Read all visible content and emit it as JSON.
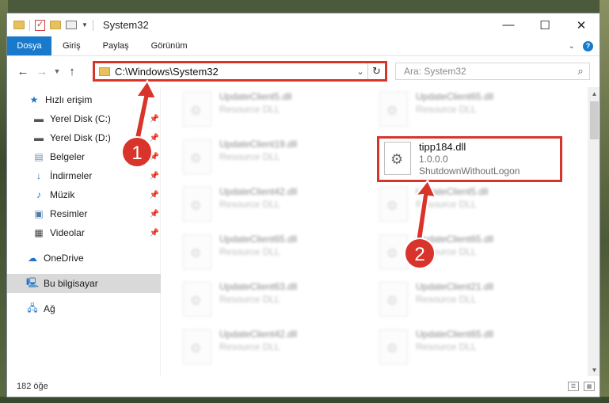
{
  "window": {
    "title": "System32",
    "controls": {
      "minimize": "—",
      "maximize": "☐",
      "close": "✕"
    }
  },
  "ribbon": {
    "tabs": [
      {
        "label": "Dosya",
        "active": true
      },
      {
        "label": "Giriş"
      },
      {
        "label": "Paylaş"
      },
      {
        "label": "Görünüm"
      }
    ]
  },
  "address": {
    "path": "C:\\Windows\\System32"
  },
  "search": {
    "placeholder": "Ara: System32"
  },
  "sidebar": {
    "items": [
      {
        "label": "Hızlı erişim",
        "icon": "star-icon"
      },
      {
        "label": "Yerel Disk (C:)",
        "icon": "drive-icon",
        "pinned": true
      },
      {
        "label": "Yerel Disk (D:)",
        "icon": "drive-icon",
        "pinned": true
      },
      {
        "label": "Belgeler",
        "icon": "documents-icon",
        "pinned": true
      },
      {
        "label": "İndirmeler",
        "icon": "download-icon",
        "pinned": true
      },
      {
        "label": "Müzik",
        "icon": "music-icon",
        "pinned": true
      },
      {
        "label": "Resimler",
        "icon": "pictures-icon",
        "pinned": true
      },
      {
        "label": "Videolar",
        "icon": "videos-icon",
        "pinned": true
      },
      {
        "label": "OneDrive",
        "icon": "onedrive-icon"
      },
      {
        "label": "Bu bilgisayar",
        "icon": "computer-icon",
        "selected": true
      },
      {
        "label": "Ağ",
        "icon": "network-icon"
      }
    ]
  },
  "files": {
    "left_column": [
      {
        "name": "UpdateClient5.dll",
        "sub": "Resource DLL"
      },
      {
        "name": "UpdateClient19.dll",
        "sub": "Resource DLL"
      },
      {
        "name": "UpdateClient42.dll",
        "sub": "Resource DLL"
      },
      {
        "name": "UpdateClient65.dll",
        "sub": "Resource DLL"
      },
      {
        "name": "UpdateClient63.dll",
        "sub": "Resource DLL"
      },
      {
        "name": "UpdateClient42.dll",
        "sub": "Resource DLL"
      }
    ],
    "right_column": [
      {
        "name": "UpdateClient65.dll",
        "sub": "Resource DLL"
      },
      {
        "name": "UpdateClient5.dll",
        "sub": "Resource DLL"
      },
      {
        "name": "UpdateClient65.dll",
        "sub": "Resource DLL"
      },
      {
        "name": "UpdateClient21.dll",
        "sub": "Resource DLL"
      },
      {
        "name": "UpdateClient65.dll",
        "sub": "Resource DLL"
      }
    ],
    "highlighted": {
      "name": "tipp184.dll",
      "version": "1.0.0.0",
      "description": "ShutdownWithoutLogon"
    }
  },
  "status": {
    "count": "182 öğe"
  },
  "annotations": {
    "step1": "1",
    "step2": "2",
    "color": "#d9342b"
  }
}
